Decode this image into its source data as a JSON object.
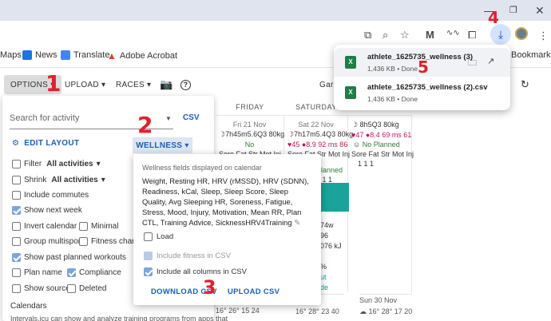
{
  "browser": {
    "bookmarks": [
      {
        "label": "Maps",
        "icon": "maps-icon"
      },
      {
        "label": "News",
        "icon": "news-icon",
        "color": "#1a73e8"
      },
      {
        "label": "Translate",
        "icon": "translate-icon",
        "color": "#4285f4"
      },
      {
        "label": "Adobe Acrobat",
        "icon": "acrobat-icon",
        "color": "#e23b2e"
      }
    ],
    "bookmarks_right": "Bookmarks",
    "downloads": [
      {
        "name": "athlete_1625735_wellness (3)",
        "status": "1,436 KB • Done"
      },
      {
        "name": "athlete_1625735_wellness (2).csv",
        "status": "1,436 KB • Done"
      }
    ]
  },
  "app_bar": {
    "options": "OPTIONS",
    "upload": "UPLOAD",
    "races": "RACES",
    "right_text": "Garm"
  },
  "calendar": {
    "headers": [
      "FRIDAY",
      "SATURDAY",
      ""
    ],
    "cells": [
      {
        "date": "Fri 21 Nov",
        "line1": "☽7h45m5.6Q3 80kg",
        "line2": "♥45 ☺ No",
        "line3": "Sore Fat Str Mot Inj"
      },
      {
        "date": "Sat 22 Nov",
        "line1": "☽7h17m5.4Q3 80kg",
        "line2": "♥45 ●8.9 92 ms 86",
        "line3": "Sore Fat Str Mot Inj"
      },
      {
        "date": "",
        "line1": "☽ 8h5Q3 80kg",
        "line2": "♥47 ●8.4 69 ms 61",
        "line3": "Sore Fat Str Mot Inj"
      }
    ],
    "card_text": "59m",
    "card_sub": "4 km",
    "detail_lines": [
      "174w",
      "196",
      "2076 kJ",
      "J",
      "",
      "0%",
      "out",
      "ride"
    ],
    "week2": [
      "Nov",
      "Sun 30 Nov"
    ],
    "planned": "Planned",
    "no": "No",
    "ones": "1 1 1",
    "weather": [
      "16° 26°",
      "15 24",
      "16° 28°",
      "23 40",
      "16° 28°",
      "17 20"
    ]
  },
  "options_panel": {
    "search_placeholder": "Search for activity",
    "csv": "CSV",
    "edit_layout": "EDIT LAYOUT",
    "wellness": "WELLNESS",
    "filter": "Filter",
    "filter_value": "All activities",
    "shrink": "Shrink",
    "shrink_value": "All activities",
    "include_commutes": "Include commutes",
    "show_next_week": "Show next week",
    "invert_calendar": "Invert calendar",
    "minimal": "Minimal",
    "group_multisport": "Group multisport",
    "fitness_chart": "Fitness chart",
    "show_past_planned": "Show past planned workouts",
    "plan_name": "Plan name",
    "compliance": "Compliance",
    "show_source": "Show source",
    "deleted": "Deleted",
    "calendars_title": "Calendars",
    "calendars_desc": "Intervals.icu can show and analyze training programs from apps that"
  },
  "wellness_popup": {
    "title": "Wellness fields displayed on calendar",
    "fields": "Weight, Resting HR, HRV (rMSSD), HRV (SDNN), Readiness, kCal, Sleep, Sleep Score, Sleep Quality, Avg Sleeping HR, Soreness, Fatigue, Stress, Mood, Injury, Motivation, Mean RR, Plan CTL, Training Advice, SicknessHRV4Training",
    "load": "Load",
    "include_fitness": "Include fitness in CSV",
    "include_all": "Include all columns in CSV",
    "download_csv": "DOWNLOAD CSV",
    "upload_csv": "UPLOAD CSV"
  },
  "annotations": [
    "1",
    "2",
    "3",
    "4",
    "5"
  ],
  "colors": {
    "accent": "#1a5fb4",
    "annotation": "#e0202a",
    "download_highlight": "#d3e3fd"
  }
}
